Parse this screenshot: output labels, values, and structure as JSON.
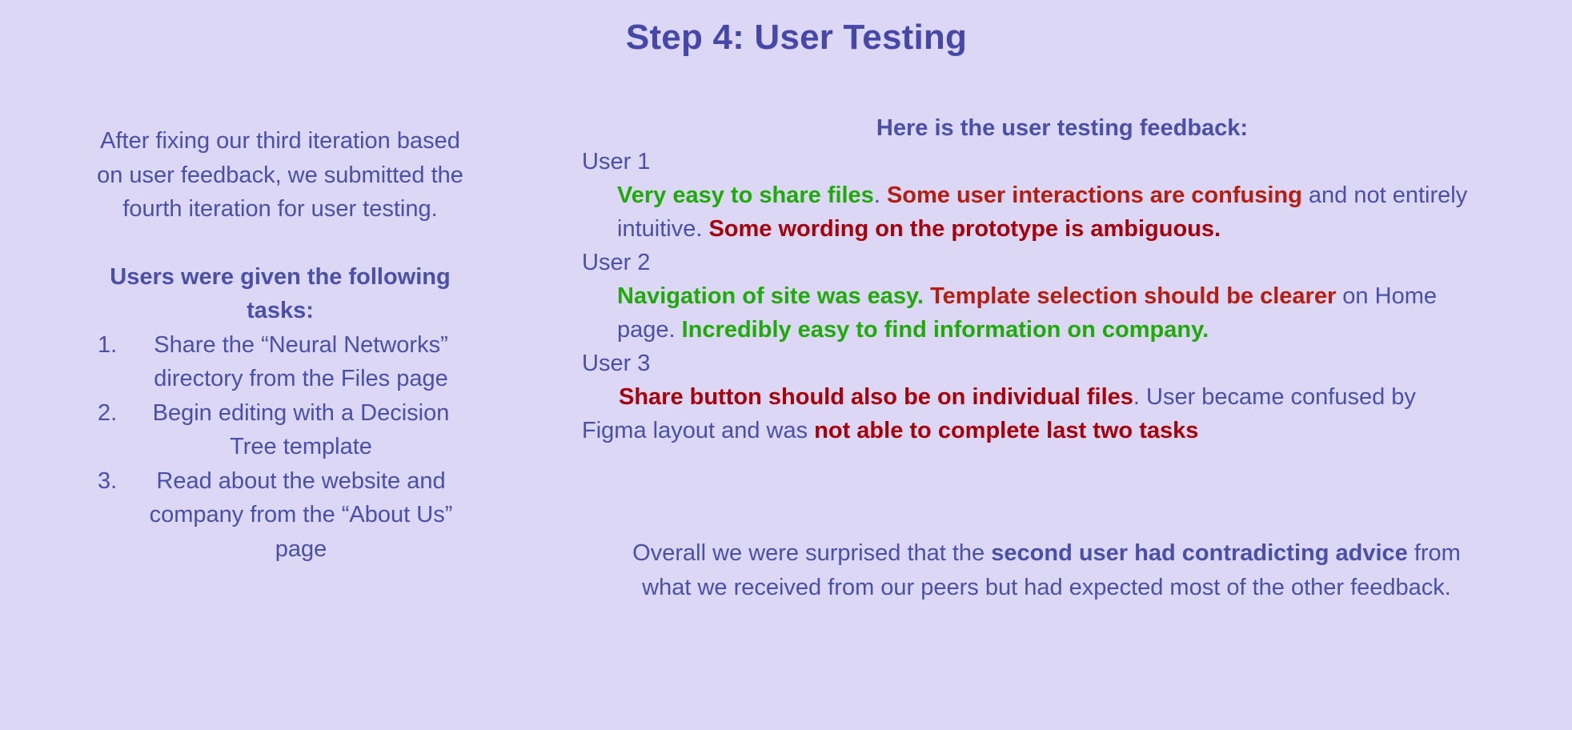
{
  "title": "Step 4: User Testing",
  "intro": "After fixing our third iteration based on user feedback, we submitted the fourth iteration for user testing.",
  "tasks_heading": "Users were given the following tasks:",
  "tasks": [
    {
      "num": "1.",
      "text": "Share the “Neural Networks” directory from the Files page"
    },
    {
      "num": "2.",
      "text": "Begin editing with a Decision Tree template"
    },
    {
      "num": "3.",
      "text": "Read about the website and company from the “About Us” page"
    }
  ],
  "feedback_heading": "Here is the user testing feedback:",
  "users": [
    {
      "label": "User 1",
      "pos1": "Very easy to share files",
      "plain1": ". ",
      "neg1": "Some user interactions are confusing",
      "plain2": " and not entirely intuitive. ",
      "neg2": "Some wording on the prototype is ambiguous."
    },
    {
      "label": "User 2",
      "pos1": "Navigation of site was easy.",
      "plain1": " ",
      "neg1": "Template selection should be clearer",
      "plain2": " on Home page. ",
      "pos2": "Incredibly easy to find information on company."
    },
    {
      "label": "User 3",
      "neg1": "Share button should also be on individual files",
      "plain1": ". User became confused by Figma layout and was ",
      "neg2": "not able to complete last two tasks"
    }
  ],
  "summary": {
    "before": "Overall we were surprised that the ",
    "emphasis": "second user had contradicting advice",
    "after": " from what we received from our peers but had expected most of the other feedback."
  },
  "colors": {
    "background": "#dcd7f5",
    "text": "#4a4fa8",
    "positive": "#1faa0a",
    "negative": "#b51d12",
    "negative_dark": "#a7000a"
  }
}
